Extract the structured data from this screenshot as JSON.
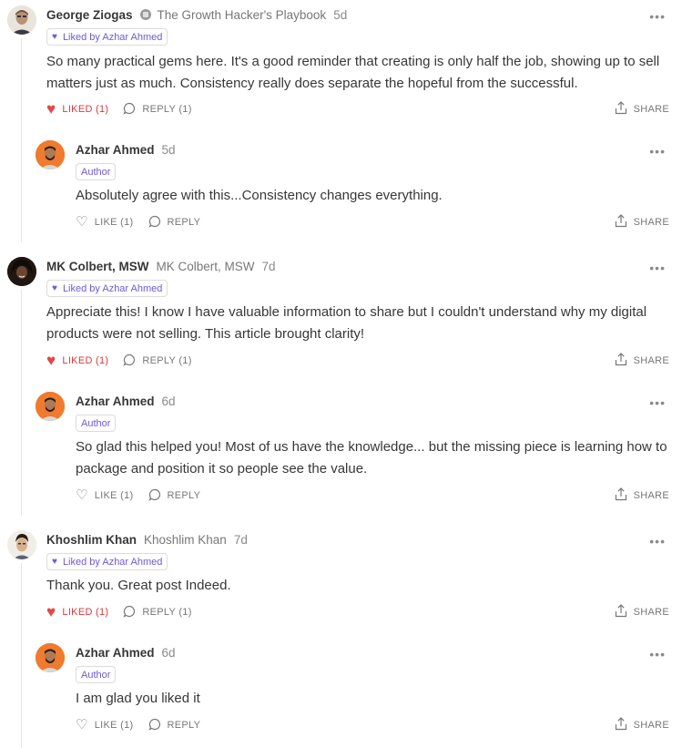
{
  "comments": [
    {
      "author": "George Ziogas",
      "publication": "The Growth Hacker's Playbook",
      "time": "5d",
      "liked_by": "Liked by Azhar Ahmed",
      "body": [
        "So many practical gems here. It's a good reminder that creating is only half the job, showing up to sell",
        "matters just as much. Consistency really does separate the hopeful from the successful."
      ],
      "like_label": "LIKED (1)",
      "reply_label": "REPLY (1)",
      "share_label": "SHARE",
      "reply": {
        "author": "Azhar Ahmed",
        "time": "5d",
        "badge": "Author",
        "body": [
          "Absolutely agree with this...Consistency changes everything."
        ],
        "like_label": "LIKE (1)",
        "reply_label": "REPLY",
        "share_label": "SHARE"
      }
    },
    {
      "author": "MK Colbert, MSW",
      "publication": "MK Colbert, MSW",
      "time": "7d",
      "liked_by": "Liked by Azhar Ahmed",
      "body": [
        "Appreciate this! I know I have valuable information to share but I couldn't understand why my digital",
        "products were not selling. This article brought clarity!"
      ],
      "like_label": "LIKED (1)",
      "reply_label": "REPLY (1)",
      "share_label": "SHARE",
      "reply": {
        "author": "Azhar Ahmed",
        "time": "6d",
        "badge": "Author",
        "body": [
          "So glad this helped you! Most of us have the knowledge... but the missing piece is learning how to",
          "package and position it so people see the value."
        ],
        "like_label": "LIKE (1)",
        "reply_label": "REPLY",
        "share_label": "SHARE"
      }
    },
    {
      "author": "Khoshlim Khan",
      "publication": "Khoshlim Khan",
      "time": "7d",
      "liked_by": "Liked by Azhar Ahmed",
      "body": [
        "Thank you. Great post Indeed."
      ],
      "like_label": "LIKED (1)",
      "reply_label": "REPLY (1)",
      "share_label": "SHARE",
      "reply": {
        "author": "Azhar Ahmed",
        "time": "6d",
        "badge": "Author",
        "body": [
          "I am glad you liked it"
        ],
        "like_label": "LIKE (1)",
        "reply_label": "REPLY",
        "share_label": "SHARE"
      }
    }
  ],
  "icons": {
    "heart_filled": "heart-filled-icon",
    "heart_outline": "heart-outline-icon",
    "reply": "speech-bubble-icon",
    "share": "share-upload-icon",
    "more": "ellipsis-icon",
    "publication": "publication-icon"
  },
  "colors": {
    "liked_red": "#d9383a",
    "accent_purple": "#6f5ad6",
    "muted_text": "#777777"
  }
}
